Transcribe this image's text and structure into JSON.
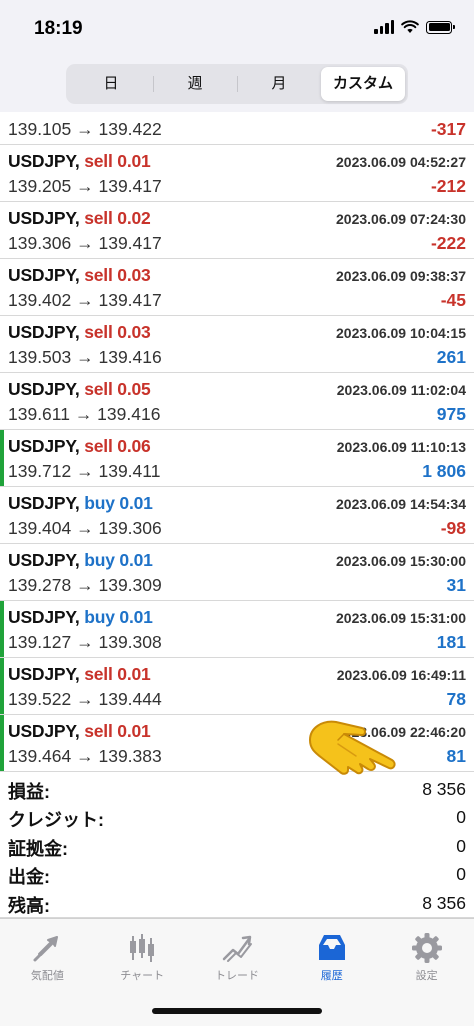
{
  "status_bar": {
    "time": "18:19"
  },
  "period_tabs": [
    {
      "label": "日",
      "active": false
    },
    {
      "label": "週",
      "active": false
    },
    {
      "label": "月",
      "active": false
    },
    {
      "label": "カスタム",
      "active": true
    }
  ],
  "trades_partial": {
    "prices": "139.105 → 139.422",
    "profit": "-317"
  },
  "trades": [
    {
      "symbol": "USDJPY,",
      "side": "sell 0.01",
      "time": "2023.06.09 04:52:27",
      "prices": "139.205 → 139.417",
      "profit": "-212"
    },
    {
      "symbol": "USDJPY,",
      "side": "sell 0.02",
      "time": "2023.06.09 07:24:30",
      "prices": "139.306 → 139.417",
      "profit": "-222"
    },
    {
      "symbol": "USDJPY,",
      "side": "sell 0.03",
      "time": "2023.06.09 09:38:37",
      "prices": "139.402 → 139.417",
      "profit": "-45"
    },
    {
      "symbol": "USDJPY,",
      "side": "sell 0.03",
      "time": "2023.06.09 10:04:15",
      "prices": "139.503 → 139.416",
      "profit": "261"
    },
    {
      "symbol": "USDJPY,",
      "side": "sell 0.05",
      "time": "2023.06.09 11:02:04",
      "prices": "139.611 → 139.416",
      "profit": "975"
    },
    {
      "symbol": "USDJPY,",
      "side": "sell 0.06",
      "time": "2023.06.09 11:10:13",
      "prices": "139.712 → 139.411",
      "profit": "1 806"
    },
    {
      "symbol": "USDJPY,",
      "side": "buy 0.01",
      "time": "2023.06.09 14:54:34",
      "prices": "139.404 → 139.306",
      "profit": "-98"
    },
    {
      "symbol": "USDJPY,",
      "side": "buy 0.01",
      "time": "2023.06.09 15:30:00",
      "prices": "139.278 → 139.309",
      "profit": "31"
    },
    {
      "symbol": "USDJPY,",
      "side": "buy 0.01",
      "time": "2023.06.09 15:31:00",
      "prices": "139.127 → 139.308",
      "profit": "181"
    },
    {
      "symbol": "USDJPY,",
      "side": "sell 0.01",
      "time": "2023.06.09 16:49:11",
      "prices": "139.522 → 139.444",
      "profit": "78"
    },
    {
      "symbol": "USDJPY,",
      "side": "sell 0.01",
      "time": "2023.06.09 22:46:20",
      "prices": "139.464 → 139.383",
      "profit": "81"
    }
  ],
  "summary": [
    {
      "label": "損益:",
      "value": "8 356"
    },
    {
      "label": "クレジット:",
      "value": "0"
    },
    {
      "label": "証拠金:",
      "value": "0"
    },
    {
      "label": "出金:",
      "value": "0"
    },
    {
      "label": "残高:",
      "value": "8 356"
    }
  ],
  "tabbar": [
    {
      "label": "気配値",
      "icon": "quotes-icon"
    },
    {
      "label": "チャート",
      "icon": "chart-icon"
    },
    {
      "label": "トレード",
      "icon": "trade-icon"
    },
    {
      "label": "履歴",
      "icon": "history-icon"
    },
    {
      "label": "設定",
      "icon": "settings-icon"
    }
  ],
  "colors": {
    "sell": "#c8332b",
    "buy": "#1e72c8",
    "profit_positive": "#1e72c8",
    "profit_negative": "#c8332b",
    "row_marker": "#20a33a",
    "tab_active": "#1b66d6"
  }
}
